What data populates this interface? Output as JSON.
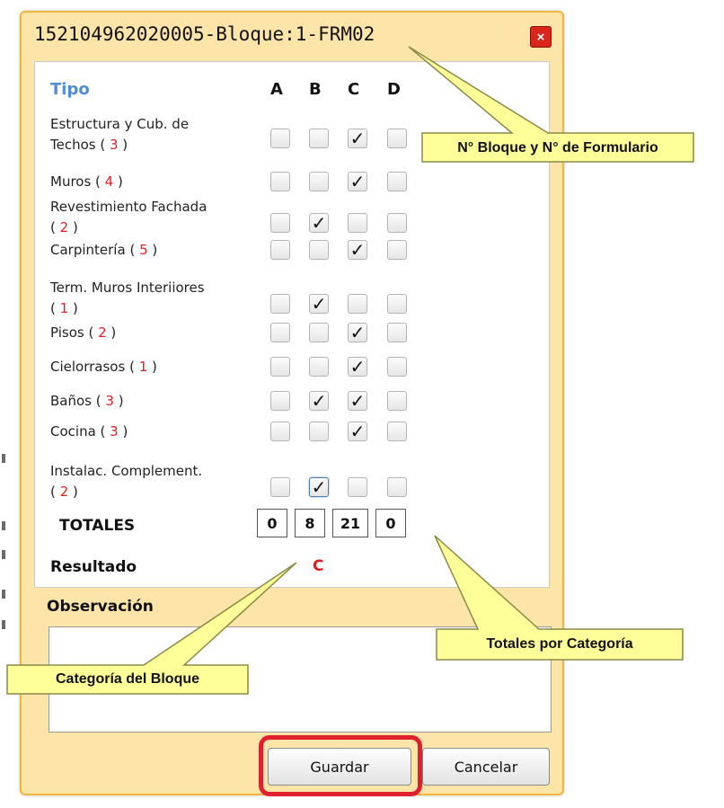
{
  "dialog": {
    "title": "152104962020005-Bloque:1-FRM02",
    "close_glyph": "×"
  },
  "columns": {
    "tipo": "Tipo",
    "headers": [
      "A",
      "B",
      "C",
      "D"
    ]
  },
  "rows": [
    {
      "label_line1": "Estructura y Cub. de",
      "label_line2": "Techos",
      "count": "3",
      "checked": [
        false,
        false,
        true,
        false
      ]
    },
    {
      "label_line1": "Muros",
      "label_line2": "",
      "count": "4",
      "checked": [
        false,
        false,
        true,
        false
      ]
    },
    {
      "label_line1": "Revestimiento Fachada",
      "label_line2": "",
      "count": "2",
      "checked": [
        false,
        true,
        false,
        false
      ]
    },
    {
      "label_line1": "Carpintería",
      "label_line2": "",
      "count": "5",
      "checked": [
        false,
        false,
        true,
        false
      ]
    },
    {
      "label_line1": "Term. Muros Interiiores",
      "label_line2": "",
      "count": "1",
      "checked": [
        false,
        true,
        false,
        false
      ]
    },
    {
      "label_line1": "Pisos",
      "label_line2": "",
      "count": "2",
      "checked": [
        false,
        false,
        true,
        false
      ]
    },
    {
      "label_line1": "Cielorrasos",
      "label_line2": "",
      "count": "1",
      "checked": [
        false,
        false,
        true,
        false
      ]
    },
    {
      "label_line1": "Baños",
      "label_line2": "",
      "count": "3",
      "checked": [
        false,
        true,
        true,
        false
      ]
    },
    {
      "label_line1": "Cocina",
      "label_line2": "",
      "count": "3",
      "checked": [
        false,
        false,
        true,
        false
      ]
    },
    {
      "label_line1": "Instalac. Complement.",
      "label_line2": "",
      "count": "2",
      "checked": [
        false,
        true,
        false,
        false
      ]
    }
  ],
  "totales": {
    "label": "TOTALES",
    "values": [
      "0",
      "8",
      "21",
      "0"
    ]
  },
  "resultado": {
    "label": "Resultado",
    "value": "C"
  },
  "observacion": {
    "label": "Observación",
    "value": ""
  },
  "buttons": {
    "save": "Guardar",
    "cancel": "Cancelar"
  },
  "callouts": {
    "bloque": "N° Bloque y N° de Formulario",
    "totales": "Totales por Categoría",
    "categoria": "Categoría del Bloque"
  },
  "colors": {
    "dialog_bg": "#fde4a8",
    "dialog_border": "#f2b73f",
    "tipo_header": "#4f8ed4",
    "count_red": "#e32020",
    "result_red": "#e01c1c",
    "callout_fill": "#ffff99",
    "highlight_red": "#e0202e"
  }
}
